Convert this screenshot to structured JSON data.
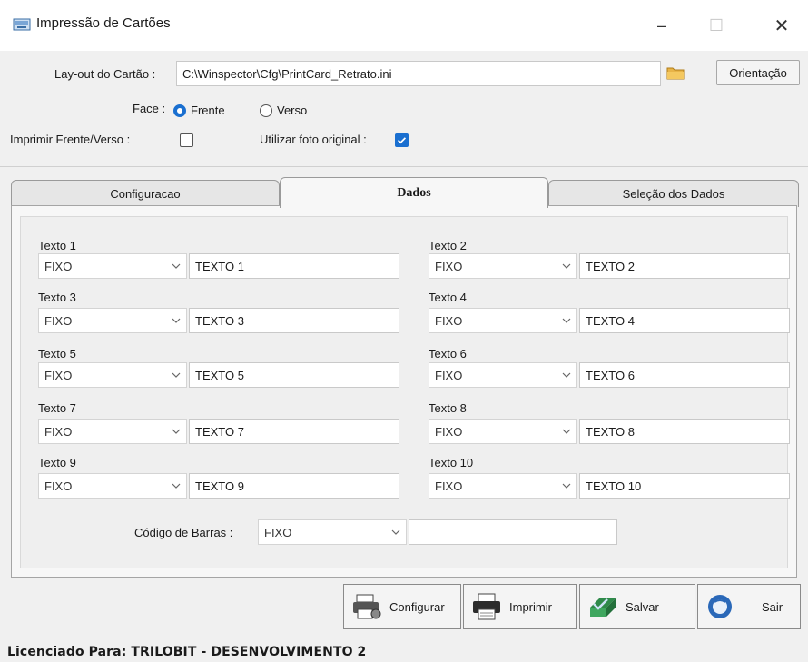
{
  "window": {
    "title": "Impressão de Cartões",
    "minimize": "–",
    "maximize": "☐",
    "close": "✕"
  },
  "header": {
    "layout_label": "Lay-out do Cartão :",
    "layout_value": "C:\\Winspector\\Cfg\\PrintCard_Retrato.ini",
    "orientation_button": "Orientação",
    "face_label": "Face :",
    "face_options": [
      "Frente",
      "Verso"
    ],
    "face_selected": "Frente",
    "print_both_label": "Imprimir Frente/Verso :",
    "print_both_checked": false,
    "original_photo_label": "Utilizar foto original :",
    "original_photo_checked": true
  },
  "tabs": [
    {
      "label": "Configuracao",
      "active": false
    },
    {
      "label": "Dados",
      "active": true
    },
    {
      "label": "Seleção dos Dados",
      "active": false
    }
  ],
  "fields": [
    {
      "label": "Texto 1",
      "source": "FIXO",
      "value": "TEXTO 1"
    },
    {
      "label": "Texto 2",
      "source": "FIXO",
      "value": "TEXTO 2"
    },
    {
      "label": "Texto 3",
      "source": "FIXO",
      "value": "TEXTO 3"
    },
    {
      "label": "Texto 4",
      "source": "FIXO",
      "value": "TEXTO 4"
    },
    {
      "label": "Texto 5",
      "source": "FIXO",
      "value": "TEXTO 5"
    },
    {
      "label": "Texto 6",
      "source": "FIXO",
      "value": "TEXTO 6"
    },
    {
      "label": "Texto 7",
      "source": "FIXO",
      "value": "TEXTO 7"
    },
    {
      "label": "Texto 8",
      "source": "FIXO",
      "value": "TEXTO 8"
    },
    {
      "label": "Texto 9",
      "source": "FIXO",
      "value": "TEXTO 9"
    },
    {
      "label": "Texto 10",
      "source": "FIXO",
      "value": "TEXTO 10"
    }
  ],
  "barcode": {
    "label": "Código de Barras :",
    "source": "FIXO",
    "value": ""
  },
  "toolbar": {
    "configure": "Configurar",
    "print": "Imprimir",
    "save": "Salvar",
    "exit": "Sair"
  },
  "status": "Licenciado Para: TRILOBIT - DESENVOLVIMENTO 2",
  "colors": {
    "accent": "#1a6fd0",
    "window_bg": "#f0f0f0"
  }
}
